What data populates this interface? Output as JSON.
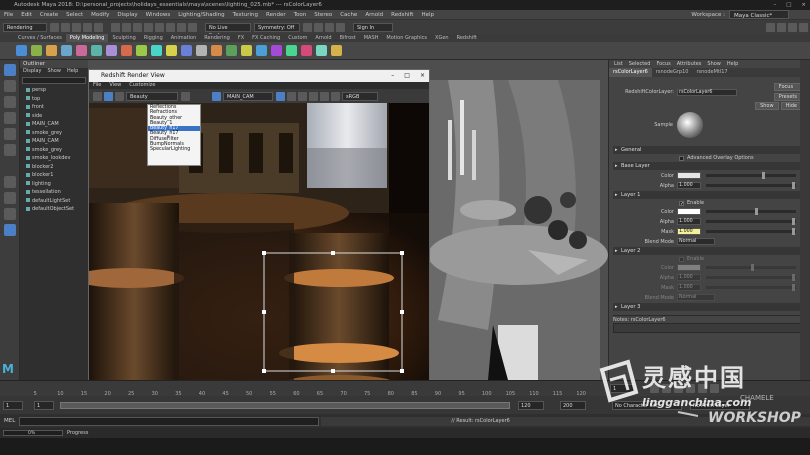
{
  "window": {
    "title": "Autodesk Maya 2018: D:\\personal_projects\\holidays_essentials\\maya\\scenes\\lighting_025.mb* --- rsColorLayer6",
    "controls": [
      "–",
      "□",
      "×"
    ]
  },
  "menubar": {
    "items": [
      "File",
      "Edit",
      "Create",
      "Select",
      "Modify",
      "Display",
      "Windows",
      "Lighting/Shading",
      "Texturing",
      "Render",
      "Toon",
      "Stereo",
      "Cache",
      "Arnold",
      "Redshift",
      "Help"
    ],
    "workspace_label": "Workspace :",
    "workspace_value": "Maya Classic*"
  },
  "statusline": {
    "menuset": "Rendering",
    "live_surface": "No Live Surface",
    "symmetry": "Symmetry: Off",
    "sign_in": "Sign In"
  },
  "shelf": {
    "tabs": [
      "Curves / Surfaces",
      "Poly Modeling",
      "Sculpting",
      "Rigging",
      "Animation",
      "Rendering",
      "FX",
      "FX Caching",
      "Custom",
      "Arnold",
      "Bifrost",
      "MASH",
      "Motion Graphics",
      "XGen",
      "Redshift"
    ],
    "active_tab": "Poly Modeling",
    "colors": [
      "#4a8fd6",
      "#8ab04a",
      "#d6a14a",
      "#6aa6c9",
      "#c96a9b",
      "#5bb3a9",
      "#a98fd6",
      "#d66a4a",
      "#9ac94a",
      "#4ad6c6",
      "#d6d04a",
      "#6a7fd6",
      "#b3b3b3",
      "#d68a4a",
      "#5aa05a",
      "#c9c94a",
      "#4a9fd6",
      "#a34ad6",
      "#4ad68f",
      "#d64a7a",
      "#7ad6c0",
      "#d6b34a"
    ]
  },
  "outliner": {
    "title": "Outliner",
    "menu": [
      "Display",
      "Show",
      "Help"
    ],
    "items": [
      "persp",
      "top",
      "front",
      "side",
      "MAIN_CAM",
      "smoke_grey",
      "MAIN_CAM",
      "smoke_grey",
      "smoke_lookdev",
      "blocker2",
      "blocker1",
      "lighting",
      "tessellation",
      "defaultLightSet",
      "defaultObjectSet"
    ]
  },
  "render_view": {
    "title": "Redshift Render View",
    "menu": [
      "File",
      "View",
      "Customize"
    ],
    "aov_selected": "Beauty",
    "camera": "MAIN_CAM",
    "color_space": "sRGB gamma",
    "aov_options": [
      "Reflections",
      "Refractions",
      "Beauty_other",
      "Beauty_1",
      "Beauty_n17",
      "Beauty_n17",
      "DiffuseFilter",
      "BumpNormals",
      "SpecularLighting"
    ],
    "aov_highlighted": "Beauty_n17"
  },
  "attribute_editor": {
    "menu": [
      "List",
      "Selected",
      "Focus",
      "Attributes",
      "Show",
      "Help"
    ],
    "tabs": [
      "rsColorLayer6",
      "rsnodeGrp10",
      "rsnodeMtl17"
    ],
    "node_label": "RedshiftColorLayer:",
    "node_name": "rsColorLayer6",
    "focus_button": "Focus",
    "presets_button": "Presets",
    "show_button": "Show",
    "hide_button": "Hide",
    "sample_label": "Sample",
    "sections": {
      "general": "General",
      "advanced": "Advanced Overlay Options",
      "base_layer": "Base Layer",
      "layer1": "Layer 1",
      "layer2": "Layer 2",
      "layer3": "Layer 3"
    },
    "base": {
      "color_label": "Color",
      "alpha_label": "Alpha",
      "alpha_value": "1.000"
    },
    "layer1": {
      "enable_label": "Enable",
      "color_label": "Color",
      "alpha_label": "Alpha",
      "alpha_value": "1.000",
      "mask_label": "Mask",
      "mask_value": "1.000",
      "blend_label": "Blend Mode",
      "blend_value": "Normal"
    },
    "layer2": {
      "enable_label": "Enable",
      "color_label": "Color",
      "alpha_label": "Alpha",
      "alpha_value": "1.000",
      "mask_label": "Mask",
      "mask_value": "1.000",
      "blend_label": "Blend Mode",
      "blend_value": "Normal"
    },
    "notes_label": "Notes: rsColorLayer6",
    "colors": {
      "base": "#e7e7e7",
      "layer1": "#ffffff",
      "layer2": "#c8c8c8"
    }
  },
  "timeline": {
    "ticks": [
      "5",
      "10",
      "15",
      "20",
      "25",
      "30",
      "35",
      "40",
      "45",
      "50",
      "55",
      "60",
      "65",
      "70",
      "75",
      "80",
      "85",
      "90",
      "95",
      "100",
      "105",
      "110",
      "115",
      "120"
    ],
    "current_frame": "1"
  },
  "range": {
    "start": "1",
    "inner_start": "1",
    "end": "120",
    "outer_end": "200",
    "character_set": "No Character Set",
    "anim_layer": "No Anim Layer"
  },
  "cmd": {
    "lang": "MEL",
    "text": "// Result: rsColorLayer6"
  },
  "help": {
    "progress_value": "0%",
    "progress_label": "Progress"
  },
  "watermark": {
    "brand_cn": "灵感中国",
    "url": "lingganchina.com",
    "brand_en": "WORKSHOP",
    "brand_en_small": "CHAMELE"
  }
}
